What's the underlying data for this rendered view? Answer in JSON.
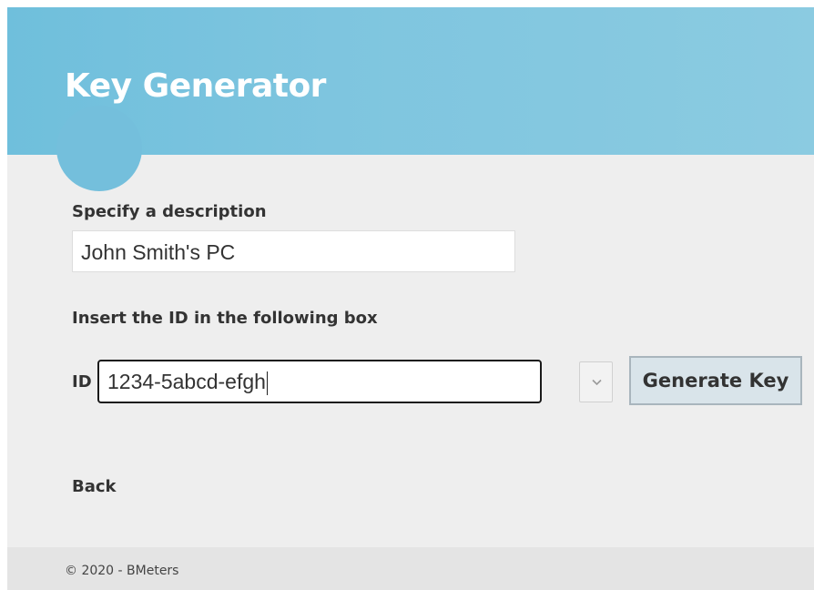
{
  "header": {
    "title": "Key Generator"
  },
  "form": {
    "description_label": "Specify a description",
    "description_value": "John Smith's PC",
    "id_instructions": "Insert the ID in the following box",
    "id_prefix": "ID",
    "id_value": "1234-5abcd-efgh",
    "dropdown_icon": "chevron-down-icon",
    "generate_button_label": "Generate Key"
  },
  "nav": {
    "back_label": "Back"
  },
  "footer": {
    "copyright": "© 2020 - BMeters"
  },
  "colors": {
    "header": "#7ec5df",
    "background": "#eeeeee",
    "footer": "#e4e4e4",
    "button": "#d9e4ea"
  }
}
